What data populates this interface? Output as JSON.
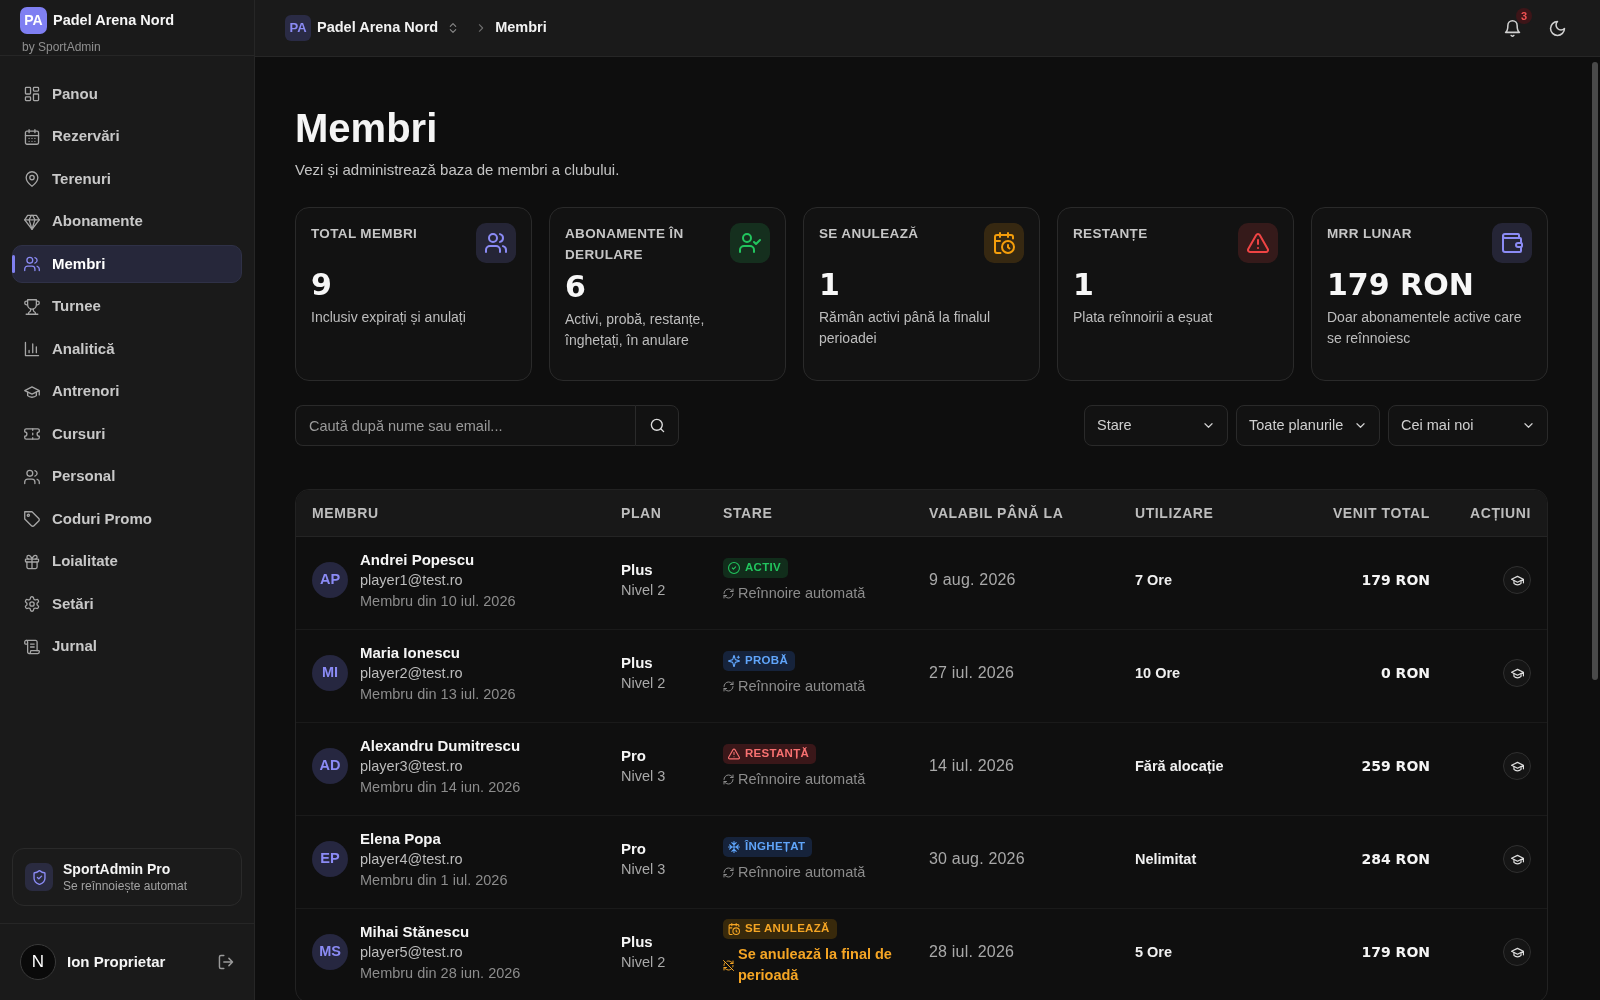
{
  "sidebar": {
    "brand": {
      "logo": "PA",
      "title": "Padel Arena Nord",
      "subtitle": "by SportAdmin"
    },
    "items": [
      {
        "label": "Panou",
        "selected": false
      },
      {
        "label": "Rezervări",
        "selected": false
      },
      {
        "label": "Terenuri",
        "selected": false
      },
      {
        "label": "Abonamente",
        "selected": false
      },
      {
        "label": "Membri",
        "selected": true
      },
      {
        "label": "Turnee",
        "selected": false
      },
      {
        "label": "Analitică",
        "selected": false
      },
      {
        "label": "Antrenori",
        "selected": false
      },
      {
        "label": "Cursuri",
        "selected": false
      },
      {
        "label": "Personal",
        "selected": false
      },
      {
        "label": "Coduri Promo",
        "selected": false
      },
      {
        "label": "Loialitate",
        "selected": false
      },
      {
        "label": "Setări",
        "selected": false
      },
      {
        "label": "Jurnal",
        "selected": false
      }
    ],
    "plan_card": {
      "title": "SportAdmin Pro",
      "subtitle": "Se reînnoiește automat"
    },
    "user": {
      "avatar": "N",
      "name": "Ion Proprietar"
    }
  },
  "top_bar": {
    "club_logo": "PA",
    "club": "Padel Arena Nord",
    "current_page": "Membri",
    "notification_count": "3"
  },
  "page": {
    "title": "Membri",
    "subtitle": "Vezi și administrează baza de membri a clubului."
  },
  "stats": [
    {
      "kind": "members",
      "label": "TOTAL MEMBRI",
      "value": "9",
      "description": "Inclusiv expirați și anulați",
      "color": "#8b8bf5"
    },
    {
      "kind": "subscriptions",
      "label": "ABONAMENTE ÎN DERULARE",
      "value": "6",
      "description": "Activi, probă, restanțe, înghețați, în anulare",
      "color": "#22c55e"
    },
    {
      "kind": "cancelling",
      "label": "SE ANULEAZĂ",
      "value": "1",
      "description": "Rămân activi până la finalul perioadei",
      "color": "#f59e0b"
    },
    {
      "kind": "overdue",
      "label": "RESTANȚE",
      "value": "1",
      "description": "Plata reînnoirii a eșuat",
      "color": "#ef4444"
    },
    {
      "kind": "revenue",
      "label": "MRR LUNAR",
      "value": "179 RON",
      "description": "Doar abonamentele active care se reînnoiesc",
      "color": "#8b8bf5"
    }
  ],
  "search": {
    "placeholder": "Caută după nume sau email..."
  },
  "filters": [
    {
      "value": "Stare"
    },
    {
      "value": "Toate planurile"
    },
    {
      "value": "Cei mai noi"
    }
  ],
  "table": {
    "columns": [
      "MEMBRU",
      "PLAN",
      "STARE",
      "VALABIL PÂNĂ LA",
      "UTILIZARE",
      "VENIT TOTAL",
      "ACȚIUNI"
    ],
    "rows": [
      {
        "initials": "AP",
        "name": "Andrei Popescu",
        "email": "player1@test.ro",
        "member_since": "Membru din 10 iul. 2026",
        "plan": "Plus",
        "plan_tier": "Nivel 2",
        "status": {
          "kind": "active",
          "label": "ACTIV"
        },
        "renewal": {
          "auto": true,
          "text": "Reînnoire automată"
        },
        "valid_until": "9 aug. 2026",
        "usage": "7 Ore",
        "revenue": "179 RON"
      },
      {
        "initials": "MI",
        "name": "Maria Ionescu",
        "email": "player2@test.ro",
        "member_since": "Membru din 13 iul. 2026",
        "plan": "Plus",
        "plan_tier": "Nivel 2",
        "status": {
          "kind": "trial",
          "label": "PROBĂ"
        },
        "renewal": {
          "auto": true,
          "text": "Reînnoire automată"
        },
        "valid_until": "27 iul. 2026",
        "usage": "10 Ore",
        "revenue": "0 RON"
      },
      {
        "initials": "AD",
        "name": "Alexandru Dumitrescu",
        "email": "player3@test.ro",
        "member_since": "Membru din 14 iun. 2026",
        "plan": "Pro",
        "plan_tier": "Nivel 3",
        "status": {
          "kind": "overdue",
          "label": "RESTANȚĂ"
        },
        "renewal": {
          "auto": true,
          "text": "Reînnoire automată"
        },
        "valid_until": "14 iul. 2026",
        "usage": "Fără alocație",
        "revenue": "259 RON"
      },
      {
        "initials": "EP",
        "name": "Elena Popa",
        "email": "player4@test.ro",
        "member_since": "Membru din 1 iul. 2026",
        "plan": "Pro",
        "plan_tier": "Nivel 3",
        "status": {
          "kind": "frozen",
          "label": "ÎNGHEȚAT"
        },
        "renewal": {
          "auto": true,
          "text": "Reînnoire automată"
        },
        "valid_until": "30 aug. 2026",
        "usage": "Nelimitat",
        "revenue": "284 RON"
      },
      {
        "initials": "MS",
        "name": "Mihai Stănescu",
        "email": "player5@test.ro",
        "member_since": "Membru din 28 iun. 2026",
        "plan": "Plus",
        "plan_tier": "Nivel 2",
        "status": {
          "kind": "canceling",
          "label": "SE ANULEAZĂ"
        },
        "renewal": {
          "auto": false,
          "text": "Se anulează la final de perioadă"
        },
        "valid_until": "28 iul. 2026",
        "usage": "5 Ore",
        "revenue": "179 RON"
      }
    ]
  }
}
